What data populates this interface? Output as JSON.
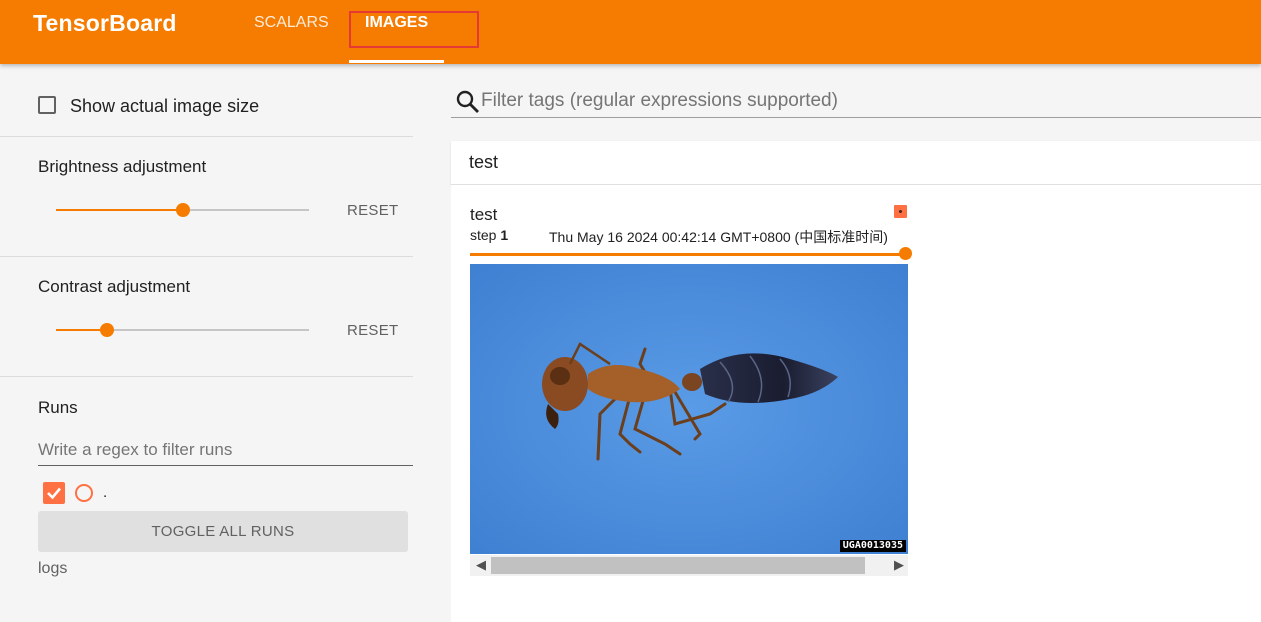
{
  "header": {
    "title": "TensorBoard",
    "tabs": [
      {
        "label": "SCALARS",
        "active": false
      },
      {
        "label": "IMAGES",
        "active": true
      }
    ],
    "color": "#f57c00"
  },
  "sidebar": {
    "show_actual_size_label": "Show actual image size",
    "brightness": {
      "label": "Brightness adjustment",
      "reset": "RESET",
      "value": 0.5
    },
    "contrast": {
      "label": "Contrast adjustment",
      "reset": "RESET",
      "value": 0.2
    },
    "runs": {
      "title": "Runs",
      "filter_placeholder": "Write a regex to filter runs",
      "items": [
        {
          "name": ".",
          "checked": true,
          "color": "#ff7043"
        }
      ],
      "toggle_all": "TOGGLE ALL RUNS",
      "dir": "logs"
    }
  },
  "main": {
    "filter_placeholder": "Filter tags (regular expressions supported)",
    "group_title": "test",
    "card": {
      "tag": "test",
      "step_label": "step",
      "step_value": "1",
      "timestamp": "Thu May 16 2024 00:42:14 GMT+0800 (中国标准时间)",
      "image_watermark": "UGA0013035",
      "image_subject": "ant photograph",
      "step_slider_value": 1.0
    }
  }
}
